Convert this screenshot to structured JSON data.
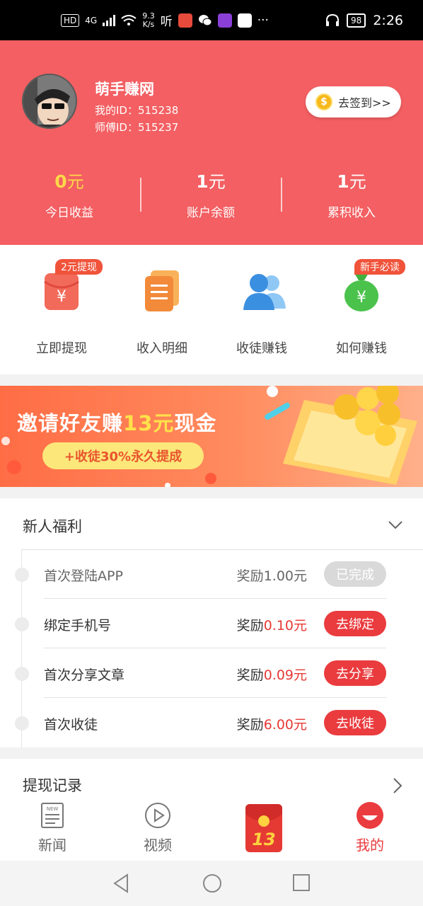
{
  "status_bar": {
    "hd": "HD",
    "network": "4G",
    "speed_top": "9.3",
    "speed_bottom": "K/s",
    "listen": "听",
    "more": "···",
    "battery": "98",
    "time": "2:26"
  },
  "profile": {
    "name": "萌手赚网",
    "user_id": "我的ID：515238",
    "master_id": "师傅ID：515237",
    "signin_label": "去签到>>",
    "coin_symbol": "$"
  },
  "stats": [
    {
      "value": "0",
      "unit": "元",
      "label": "今日收益"
    },
    {
      "value": "1",
      "unit": "元",
      "label": "账户余额"
    },
    {
      "value": "1",
      "unit": "元",
      "label": "累积收入"
    }
  ],
  "shortcuts": [
    {
      "label": "立即提现",
      "badge": "2元提现",
      "icon": "red-envelope-icon"
    },
    {
      "label": "收入明细",
      "icon": "document-list-icon"
    },
    {
      "label": "收徒赚钱",
      "icon": "users-icon"
    },
    {
      "label": "如何赚钱",
      "badge": "新手必读",
      "icon": "money-bag-icon"
    }
  ],
  "banner": {
    "title_pre": "邀请好友赚",
    "title_highlight": "13元",
    "title_post": "现金",
    "pill": "+收徒30%永久提成"
  },
  "welfare": {
    "title": "新人福利",
    "tasks": [
      {
        "name": "首次登陆APP",
        "reward_prefix": "奖励",
        "reward_amount": "1.00元",
        "button": "已完成",
        "done": true
      },
      {
        "name": "绑定手机号",
        "reward_prefix": "奖励",
        "reward_amount": "0.10元",
        "button": "去绑定",
        "done": false
      },
      {
        "name": "首次分享文章",
        "reward_prefix": "奖励",
        "reward_amount": "0.09元",
        "button": "去分享",
        "done": false
      },
      {
        "name": "首次收徒",
        "reward_prefix": "奖励",
        "reward_amount": "6.00元",
        "button": "去收徒",
        "done": false
      }
    ]
  },
  "record": {
    "title": "提现记录"
  },
  "tabbar": {
    "news": "新闻",
    "news_icon_text": "NEW",
    "video": "视频",
    "packet_number": "13",
    "mine": "我的"
  },
  "colors": {
    "header_bg": "#f35f62",
    "accent_red": "#ea3b3e",
    "highlight_yellow": "#ffd84a"
  }
}
